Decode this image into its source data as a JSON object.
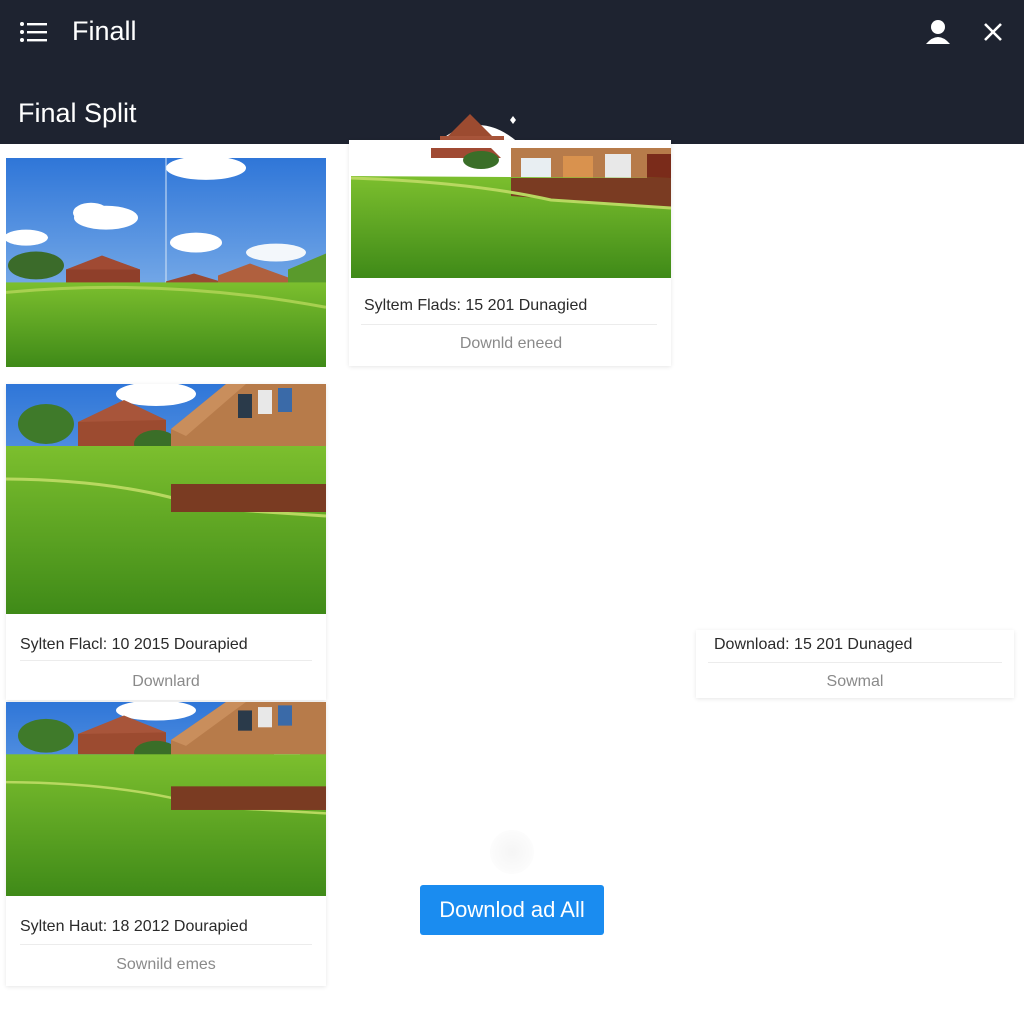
{
  "header": {
    "app_title": "Finall",
    "page_title": "Final Split"
  },
  "cards": [
    {
      "info": "Syltem Flads: 15 201 Dunagied",
      "action": "Downld eneed"
    },
    {
      "info": "Sylten Flacl: 10 2015 Dourapied",
      "action": "Downlard"
    },
    {
      "info": "Download: 15 201 Dunaged",
      "action": "Sowmal"
    },
    {
      "info": "Sylten Haut: 18 2012 Dourapied",
      "action": "Sownild emes"
    }
  ],
  "download_all_label": "Downlod ad All",
  "icons": {
    "menu": "menu-icon",
    "user": "user-icon",
    "close": "close-icon"
  },
  "colors": {
    "topbar": "#1e2330",
    "accent": "#1a8cf0"
  }
}
